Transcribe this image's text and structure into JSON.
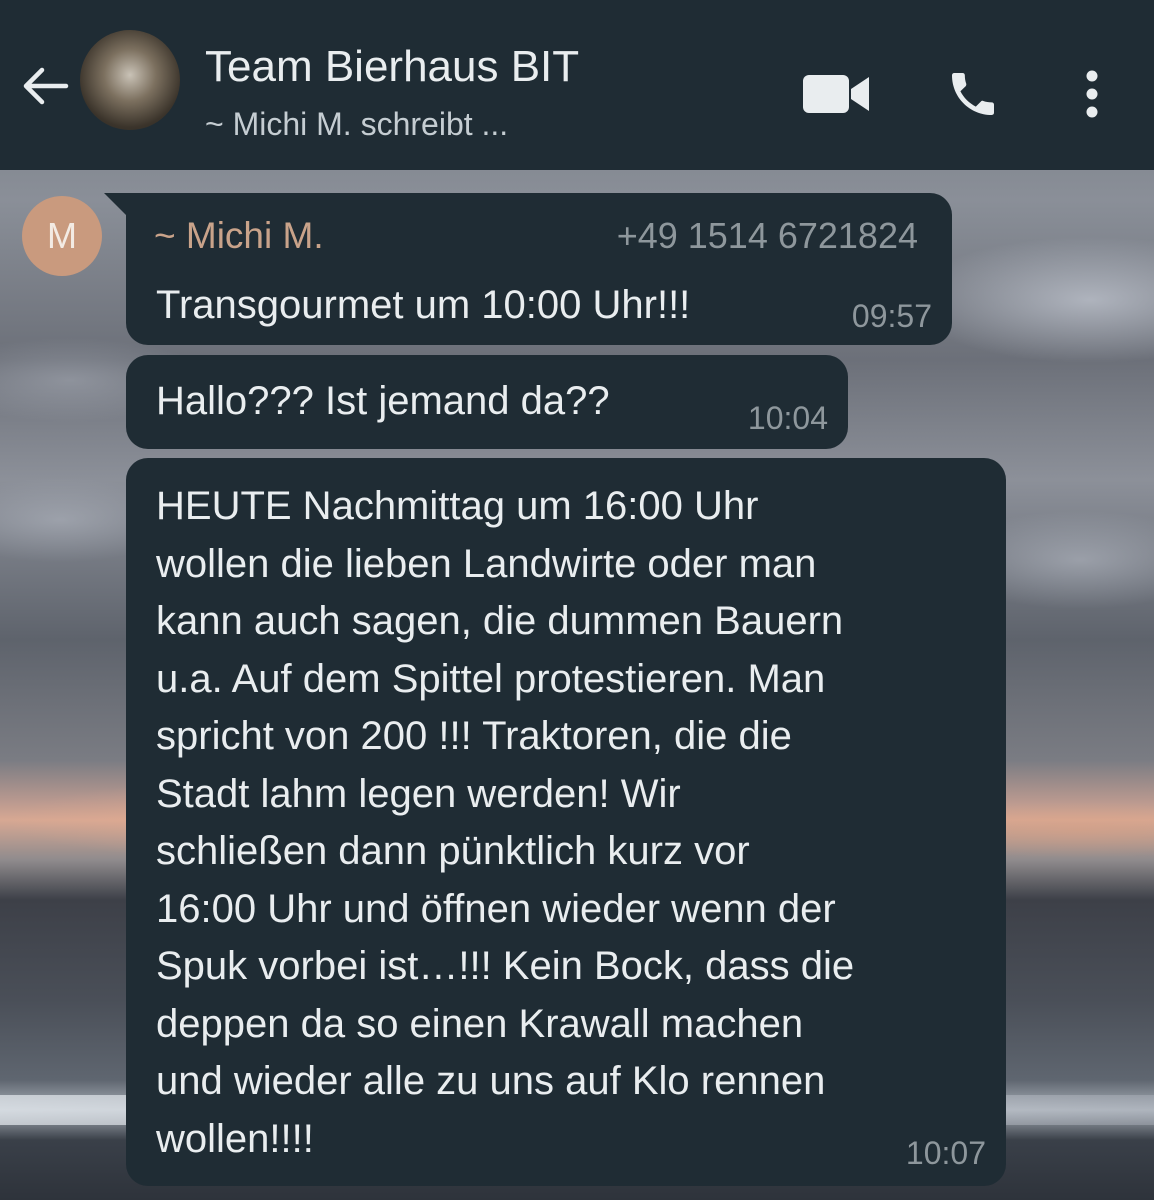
{
  "header": {
    "title": "Team Bierhaus BIT",
    "subtitle": "~ Michi M. schreibt ...",
    "icons": [
      "back-arrow-icon",
      "group-avatar",
      "video-call-icon",
      "phone-call-icon",
      "more-options-icon"
    ]
  },
  "messages": [
    {
      "avatar_letter": "M",
      "sender": "~ Michi M.",
      "phone": "+49 1514 6721824",
      "lines": [
        "Transgourmet um 10:00 Uhr!!!"
      ],
      "time": "09:57"
    },
    {
      "lines": [
        "Hallo??? Ist jemand da??"
      ],
      "time": "10:04"
    },
    {
      "lines": [
        "HEUTE Nachmittag um 16:00 Uhr",
        "wollen die lieben Landwirte oder man",
        "kann auch sagen, die dummen Bauern",
        "u.a. Auf dem Spittel protestieren. Man",
        "spricht von 200 !!! Traktoren, die die",
        "Stadt lahm legen werden! Wir",
        "schließen dann pünktlich kurz vor",
        "16:00 Uhr und öffnen wieder wenn der",
        "Spuk vorbei ist…!!! Kein Bock, dass die",
        "deppen da so einen Krawall machen",
        "und wieder alle zu uns auf Klo rennen",
        "wollen!!!!"
      ],
      "time": "10:07"
    }
  ],
  "colors": {
    "header_bg": "#1f2c34",
    "bubble_bg": "#1f2c34",
    "text": "#e9edef",
    "sender_name": "#c9a38a",
    "meta": "#8e979c",
    "avatar_bg": "#c99a7e"
  }
}
